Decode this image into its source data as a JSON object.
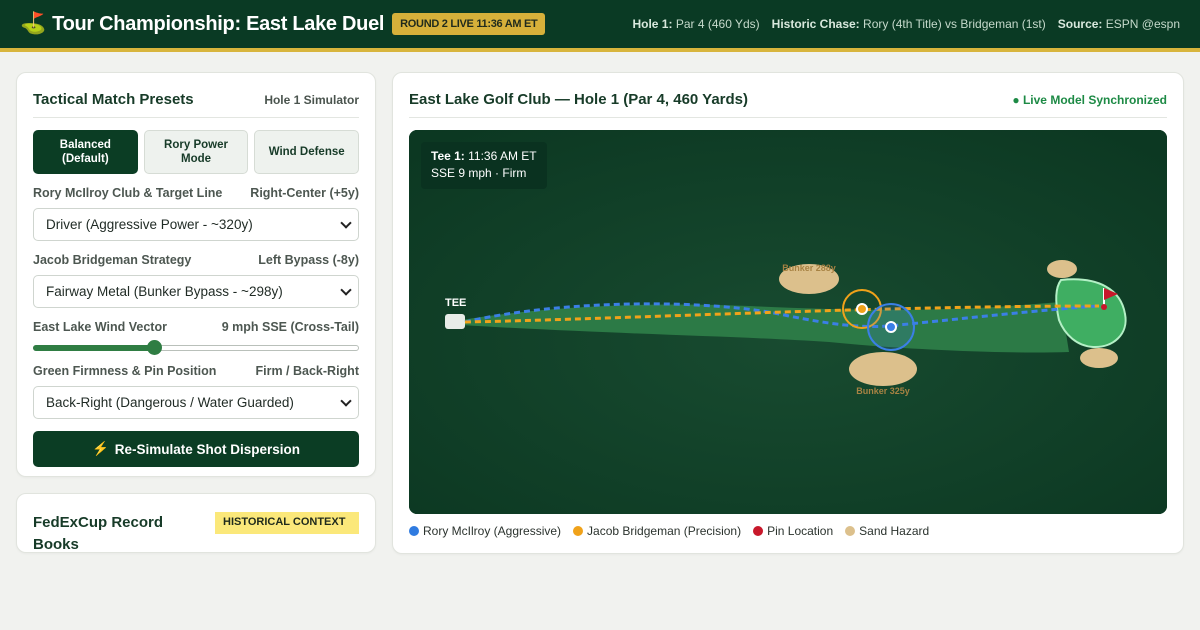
{
  "header": {
    "title": "Tour Championship: East Lake Duel",
    "live_badge": "ROUND 2 LIVE 11:36 AM ET",
    "meta": [
      {
        "label": "Hole 1:",
        "value": "Par 4 (460 Yds)"
      },
      {
        "label": "Historic Chase:",
        "value": "Rory (4th Title) vs Bridgeman (1st)"
      },
      {
        "label": "Source:",
        "value": "ESPN @espn"
      }
    ],
    "flag_icon": "golf-flag-icon"
  },
  "presets_card": {
    "title": "Tactical Match Presets",
    "subtitle": "Hole 1 Simulator",
    "presets": [
      {
        "label": "Balanced (Default)",
        "active": true
      },
      {
        "label": "Rory Power Mode",
        "active": false
      },
      {
        "label": "Wind Defense",
        "active": false
      }
    ],
    "rory": {
      "label": "Rory McIlroy Club & Target Line",
      "value": "Right-Center (+5y)",
      "selected": "Driver (Aggressive Power - ~320y)"
    },
    "bridgeman": {
      "label": "Jacob Bridgeman Strategy",
      "value": "Left Bypass (-8y)",
      "selected": "Fairway Metal (Bunker Bypass - ~298y)"
    },
    "wind": {
      "label": "East Lake Wind Vector",
      "value": "9 mph SSE (Cross-Tail)",
      "level": 0.37
    },
    "green": {
      "label": "Green Firmness & Pin Position",
      "value": "Firm / Back-Right",
      "selected": "Back-Right (Dangerous / Water Guarded)"
    },
    "simulate_button": "Re-Simulate Shot Dispersion"
  },
  "records_card": {
    "title": "FedExCup Record Books",
    "badge": "HISTORICAL CONTEXT"
  },
  "map_card": {
    "title": "East Lake Golf Club — Hole 1 (Par 4, 460 Yards)",
    "status": "● Live Model Synchronized",
    "info_label": "Tee 1:",
    "info_time": "11:36 AM ET",
    "info_conditions": "SSE 9 mph · Firm",
    "tee_label": "TEE",
    "bunker_upper": "Bunker 288y",
    "bunker_lower": "Bunker 325y",
    "legend": [
      {
        "label": "Rory McIlroy (Aggressive)",
        "color": "#2f7be0"
      },
      {
        "label": "Jacob Bridgeman (Precision)",
        "color": "#f0a21a"
      },
      {
        "label": "Pin Location",
        "color": "#c8182b"
      },
      {
        "label": "Sand Hazard",
        "color": "#dcc08c"
      }
    ]
  }
}
